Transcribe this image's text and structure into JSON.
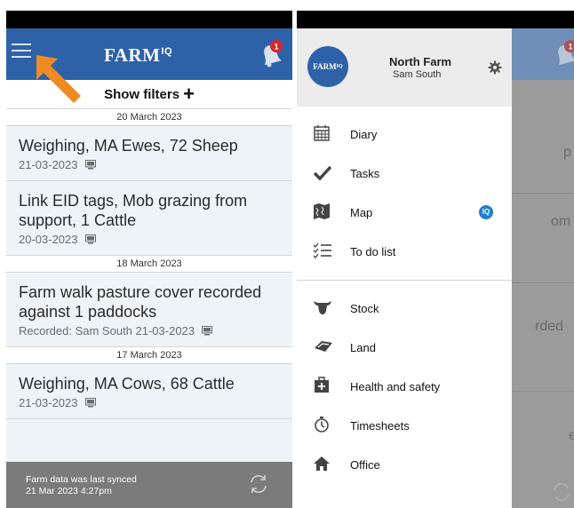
{
  "left": {
    "app_title": "FARM",
    "app_title_sup": "IQ",
    "notification_count": "1",
    "filters_label": "Show filters",
    "feed": [
      {
        "date": "20 March 2023",
        "items": [
          {
            "title": "Weighing, MA Ewes, 72 Sheep",
            "sub": "21-03-2023"
          },
          {
            "title": "Link EID tags, Mob grazing from support, 1 Cattle",
            "sub": "20-03-2023"
          }
        ]
      },
      {
        "date": "18 March 2023",
        "items": [
          {
            "title": "Farm walk pasture cover recorded against 1 paddocks",
            "sub": "Recorded: Sam South 21-03-2023"
          }
        ]
      },
      {
        "date": "17 March 2023",
        "items": [
          {
            "title": "Weighing, MA Cows, 68 Cattle",
            "sub": "21-03-2023"
          }
        ]
      }
    ],
    "sync_line1": "Farm data was last synced",
    "sync_line2": "21 Mar 2023 4:27pm"
  },
  "right": {
    "notification_count": "1",
    "drawer": {
      "logo": "FARM",
      "logo_sup": "IQ",
      "farm_name": "North Farm",
      "user_name": "Sam South",
      "group1": [
        {
          "label": "Diary",
          "icon": "calendar-icon"
        },
        {
          "label": "Tasks",
          "icon": "check-icon"
        },
        {
          "label": "Map",
          "icon": "map-icon",
          "badge": "IQ"
        },
        {
          "label": "To do list",
          "icon": "checklist-icon"
        }
      ],
      "group2": [
        {
          "label": "Stock",
          "icon": "cow-icon"
        },
        {
          "label": "Land",
          "icon": "land-icon"
        },
        {
          "label": "Health and safety",
          "icon": "first-aid-icon"
        },
        {
          "label": "Timesheets",
          "icon": "stopwatch-icon"
        },
        {
          "label": "Office",
          "icon": "home-icon"
        }
      ]
    },
    "ghost": [
      "p",
      "om",
      "rded",
      "e"
    ]
  },
  "colors": {
    "brand_blue": "#2e62a8",
    "badge_red": "#d9262c",
    "arrow_orange": "#f08a24"
  }
}
